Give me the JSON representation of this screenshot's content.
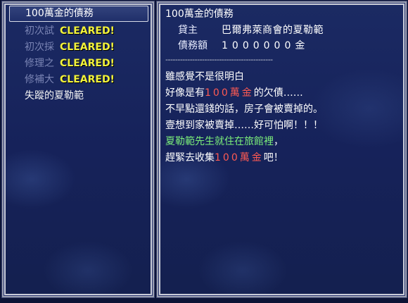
{
  "quests": [
    {
      "label": "100萬金的債務",
      "stamp": "",
      "selected": true
    },
    {
      "label": "初次試",
      "stamp": "CLEARED!"
    },
    {
      "label": "初次採",
      "stamp": "CLEARED!"
    },
    {
      "label": "修理之",
      "stamp": "CLEARED!"
    },
    {
      "label": "修補大",
      "stamp": "CLEARED!"
    },
    {
      "label": "失蹤的夏勒範",
      "stamp": ""
    }
  ],
  "detail": {
    "title": "100萬金的債務",
    "client_key": "貸主",
    "client_value": "巴爾弗萊商會的夏勒範",
    "amount_key": "債務額",
    "amount_value": "1000000金",
    "separator": "--------------------------------------------",
    "lines": [
      {
        "text": "雖感覺不是很明白"
      },
      {
        "pre": "好像是有",
        "hl": "100萬金",
        "post": "的欠債……"
      },
      {
        "text": "不早點還錢的話，房子會被賣掉的。"
      },
      {
        "text": "壹想到家被賣掉……好可怕啊！！！"
      },
      {
        "green": "夏勒範先生就住在旅館裡",
        "post": "，"
      },
      {
        "pre": "趕緊去收集",
        "hl": "100萬金",
        "post": "吧！"
      }
    ]
  },
  "colors": {
    "stamp": "#f2f23a",
    "highlight": "#ff5a52",
    "npc": "#7cf07a",
    "panel_bg": "#1b2a63"
  }
}
